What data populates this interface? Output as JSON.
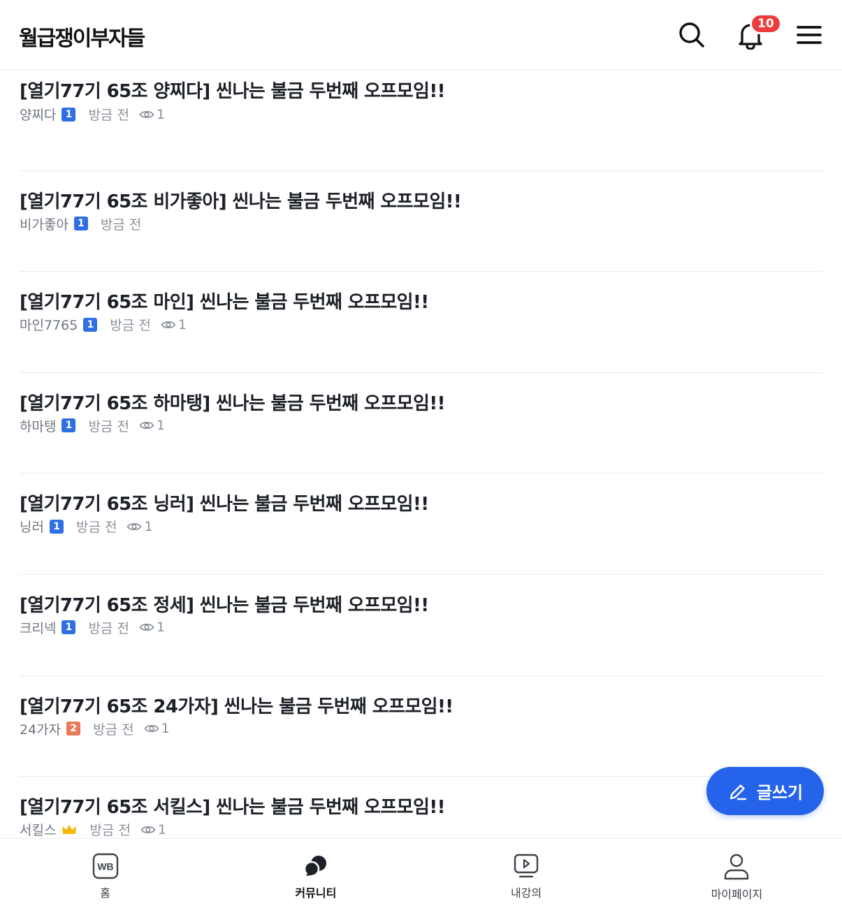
{
  "header": {
    "logo": "월급쟁이부자들",
    "notification_count": "10"
  },
  "posts": [
    {
      "title": "[열기77기 65조 양찌다] 씬나는 불금 두번째 오프모임!!",
      "author": "양찌다",
      "level": "1",
      "level_color": "#2f6fe4",
      "time": "방금 전",
      "views": "1"
    },
    {
      "title": "[열기77기 65조 비가좋아] 씬나는 불금 두번째 오프모임!!",
      "author": "비가좋아",
      "level": "1",
      "level_color": "#2f6fe4",
      "time": "방금 전",
      "views": ""
    },
    {
      "title": "[열기77기 65조 마인] 씬나는 불금 두번째 오프모임!!",
      "author": "마인7765",
      "level": "1",
      "level_color": "#2f6fe4",
      "time": "방금 전",
      "views": "1"
    },
    {
      "title": "[열기77기 65조 하마탱] 씬나는 불금 두번째 오프모임!!",
      "author": "하마탱",
      "level": "1",
      "level_color": "#2f6fe4",
      "time": "방금 전",
      "views": "1"
    },
    {
      "title": "[열기77기 65조 닝러] 씬나는 불금 두번째 오프모임!!",
      "author": "닝러",
      "level": "1",
      "level_color": "#2f6fe4",
      "time": "방금 전",
      "views": "1"
    },
    {
      "title": "[열기77기 65조 정세] 씬나는 불금 두번째 오프모임!!",
      "author": "크리넥",
      "level": "1",
      "level_color": "#2f6fe4",
      "time": "방금 전",
      "views": "1"
    },
    {
      "title": "[열기77기 65조 24가자] 씬나는 불금 두번째 오프모임!!",
      "author": "24가자",
      "level": "2",
      "level_color": "#e8795a",
      "time": "방금 전",
      "views": "1"
    },
    {
      "title": "[열기77기 65조 서킬스] 씬나는 불금 두번째 오프모임!!",
      "author": "서킬스",
      "level": "crown",
      "level_color": "#f5b800",
      "time": "방금 전",
      "views": "1"
    }
  ],
  "write_button": {
    "label": "글쓰기"
  },
  "bottom_nav": [
    {
      "label": "홈",
      "icon": "wb-home-icon"
    },
    {
      "label": "커뮤니티",
      "icon": "community-icon"
    },
    {
      "label": "내강의",
      "icon": "my-lecture-icon"
    },
    {
      "label": "마이페이지",
      "icon": "my-page-icon"
    }
  ],
  "colors": {
    "accent": "#2563eb",
    "badge_red": "#ef3b3b"
  }
}
